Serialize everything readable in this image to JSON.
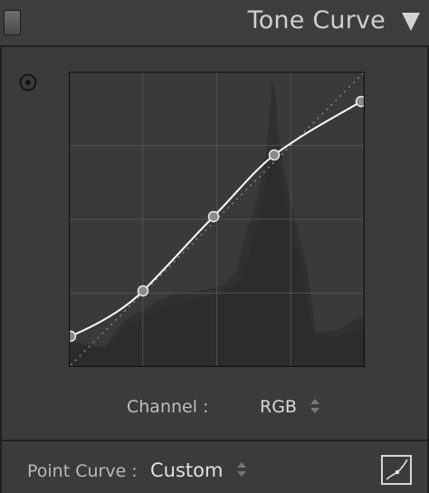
{
  "panel": {
    "title": "Tone Curve"
  },
  "icons": {
    "collapse": "triangle-down-icon",
    "panel_toggle": "panel-switch-icon",
    "target_adjust": "target-adjust-icon",
    "channel_stepper": "updown-arrows-icon",
    "point_curve_stepper": "updown-arrows-icon",
    "curve_toggle": "point-curve-icon"
  },
  "channel": {
    "label": "Channel :",
    "value": "RGB"
  },
  "point_curve": {
    "label": "Point Curve :",
    "value": "Custom"
  },
  "colors": {
    "panel_bg": "#3b3b3b",
    "graph_bg": "#3a3a3a",
    "histogram": "#2f2f2f",
    "curve": "#ffffff",
    "control_point_fill": "#8a8a8a"
  }
}
